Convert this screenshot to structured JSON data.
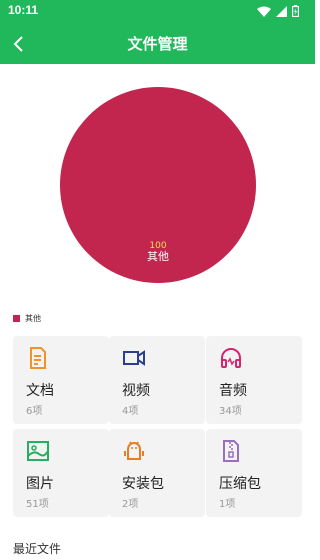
{
  "status_bar": {
    "time": "10:11"
  },
  "app_bar": {
    "title": "文件管理"
  },
  "chart_data": {
    "type": "pie",
    "categories": [
      "其他"
    ],
    "values": [
      100
    ],
    "colors": [
      "#c2254e"
    ],
    "data_label": "100",
    "slice_label": "其他",
    "legend": [
      "其他"
    ]
  },
  "categories": [
    {
      "name": "文档",
      "count": "6项",
      "icon": "document-icon",
      "color": "#f0932b"
    },
    {
      "name": "视频",
      "count": "4项",
      "icon": "video-icon",
      "color": "#2c3e8f"
    },
    {
      "name": "音频",
      "count": "34项",
      "icon": "headphones-icon",
      "color": "#d6246e"
    },
    {
      "name": "图片",
      "count": "51项",
      "icon": "image-icon",
      "color": "#27ae60"
    },
    {
      "name": "安装包",
      "count": "2项",
      "icon": "android-icon",
      "color": "#e67e22"
    },
    {
      "name": "压缩包",
      "count": "1项",
      "icon": "zip-icon",
      "color": "#9b6fc0"
    }
  ],
  "recent": {
    "title": "最近文件"
  },
  "colors": {
    "brand": "#20b85a",
    "card_bg": "#f3f3f3"
  }
}
